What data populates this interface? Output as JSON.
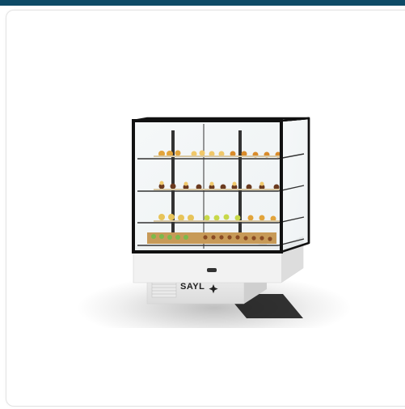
{
  "product": {
    "brand_logo": "SAYL",
    "icons": [
      "sparkle-icon"
    ]
  },
  "colors": {
    "top_bar": "#0d4a66",
    "card_border": "#e3e3e3",
    "frame": "#111111"
  }
}
